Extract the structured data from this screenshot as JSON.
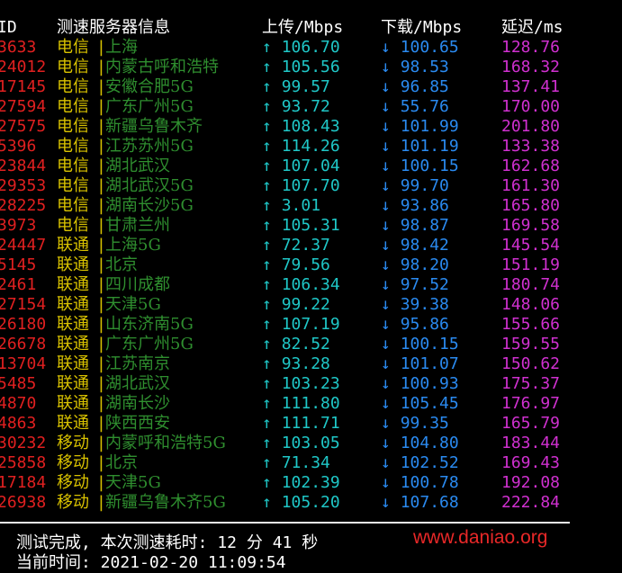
{
  "header": {
    "id": "ID",
    "server": "测速服务器信息",
    "upload": "上传/Mbps",
    "download": "下载/Mbps",
    "latency": "延迟/ms"
  },
  "rows": [
    {
      "id": "3633",
      "isp": "电信",
      "city": "上海",
      "up": "106.70",
      "down": "100.65",
      "lat": "128.76"
    },
    {
      "id": "24012",
      "isp": "电信",
      "city": "内蒙古呼和浩特",
      "up": "105.56",
      "down": "98.53",
      "lat": "168.32"
    },
    {
      "id": "17145",
      "isp": "电信",
      "city": "安徽合肥5G",
      "up": "99.57",
      "down": "96.85",
      "lat": "137.41"
    },
    {
      "id": "27594",
      "isp": "电信",
      "city": "广东广州5G",
      "up": "93.72",
      "down": "55.76",
      "lat": "170.00"
    },
    {
      "id": "27575",
      "isp": "电信",
      "city": "新疆乌鲁木齐",
      "up": "108.43",
      "down": "101.99",
      "lat": "201.80"
    },
    {
      "id": "5396",
      "isp": "电信",
      "city": "江苏苏州5G",
      "up": "114.26",
      "down": "101.19",
      "lat": "133.38"
    },
    {
      "id": "23844",
      "isp": "电信",
      "city": "湖北武汉",
      "up": "107.04",
      "down": "100.15",
      "lat": "162.68"
    },
    {
      "id": "29353",
      "isp": "电信",
      "city": "湖北武汉5G",
      "up": "107.70",
      "down": "99.70",
      "lat": "161.30"
    },
    {
      "id": "28225",
      "isp": "电信",
      "city": "湖南长沙5G",
      "up": "3.01",
      "down": "93.86",
      "lat": "165.80"
    },
    {
      "id": "3973",
      "isp": "电信",
      "city": "甘肃兰州",
      "up": "105.31",
      "down": "98.87",
      "lat": "169.58"
    },
    {
      "id": "24447",
      "isp": "联通",
      "city": "上海5G",
      "up": "72.37",
      "down": "98.42",
      "lat": "145.54"
    },
    {
      "id": "5145",
      "isp": "联通",
      "city": "北京",
      "up": "79.56",
      "down": "98.20",
      "lat": "151.19"
    },
    {
      "id": "2461",
      "isp": "联通",
      "city": "四川成都",
      "up": "106.34",
      "down": "97.52",
      "lat": "180.74"
    },
    {
      "id": "27154",
      "isp": "联通",
      "city": "天津5G",
      "up": "99.22",
      "down": "39.38",
      "lat": "148.06"
    },
    {
      "id": "26180",
      "isp": "联通",
      "city": "山东济南5G",
      "up": "107.19",
      "down": "95.86",
      "lat": "155.66"
    },
    {
      "id": "26678",
      "isp": "联通",
      "city": "广东广州5G",
      "up": "82.52",
      "down": "100.15",
      "lat": "159.55"
    },
    {
      "id": "13704",
      "isp": "联通",
      "city": "江苏南京",
      "up": "93.28",
      "down": "101.07",
      "lat": "150.62"
    },
    {
      "id": "5485",
      "isp": "联通",
      "city": "湖北武汉",
      "up": "103.23",
      "down": "100.93",
      "lat": "175.37"
    },
    {
      "id": "4870",
      "isp": "联通",
      "city": "湖南长沙",
      "up": "111.80",
      "down": "105.45",
      "lat": "176.97"
    },
    {
      "id": "4863",
      "isp": "联通",
      "city": "陕西西安",
      "up": "111.71",
      "down": "99.35",
      "lat": "165.79"
    },
    {
      "id": "30232",
      "isp": "移动",
      "city": "内蒙呼和浩特5G",
      "up": "103.05",
      "down": "104.80",
      "lat": "183.44"
    },
    {
      "id": "25858",
      "isp": "移动",
      "city": "北京",
      "up": "71.34",
      "down": "102.52",
      "lat": "169.43"
    },
    {
      "id": "17184",
      "isp": "移动",
      "city": "天津5G",
      "up": "102.39",
      "down": "100.78",
      "lat": "192.08"
    },
    {
      "id": "26938",
      "isp": "移动",
      "city": "新疆乌鲁木齐5G",
      "up": "105.20",
      "down": "107.68",
      "lat": "222.84"
    }
  ],
  "symbols": {
    "separator": "|",
    "up_arrow": "↑",
    "down_arrow": "↓"
  },
  "footer": {
    "completed": "测试完成, 本次测速耗时: 12 分 41 秒",
    "current_time": "当前时间: 2021-02-20 11:09:54"
  },
  "watermark": "www.daniao.org",
  "colors": {
    "background": "#000000",
    "id": "#e02020",
    "isp": "#d9c200",
    "city": "#2f8f2f",
    "upload": "#1fc7c7",
    "download": "#2a8af0",
    "latency": "#d030d0",
    "watermark": "#e82828"
  }
}
